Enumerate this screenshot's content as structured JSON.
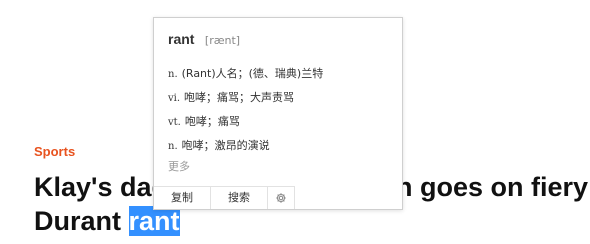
{
  "article": {
    "category": "Sports",
    "headline_line1": "Klay's dad Mychal Thompson goes on fiery",
    "headline_line2_prefix": "Durant ",
    "headline_selected_word": "rant"
  },
  "dictionary_popup": {
    "word": "rant",
    "phonetic": "[rænt]",
    "definitions": [
      {
        "pos": "n.",
        "meaning": "(Rant)人名；(德、瑞典)兰特"
      },
      {
        "pos": "vi.",
        "meaning": "咆哮；痛骂；大声责骂"
      },
      {
        "pos": "vt.",
        "meaning": "咆哮；痛骂"
      },
      {
        "pos": "n.",
        "meaning": "咆哮；激昂的演说"
      }
    ],
    "more_label": "更多",
    "toolbar": {
      "copy_label": "复制",
      "search_label": "搜索",
      "settings_icon": "gear-icon"
    }
  },
  "colors": {
    "category": "#e8531f",
    "selection": "#3390ff",
    "headline": "#111111"
  }
}
